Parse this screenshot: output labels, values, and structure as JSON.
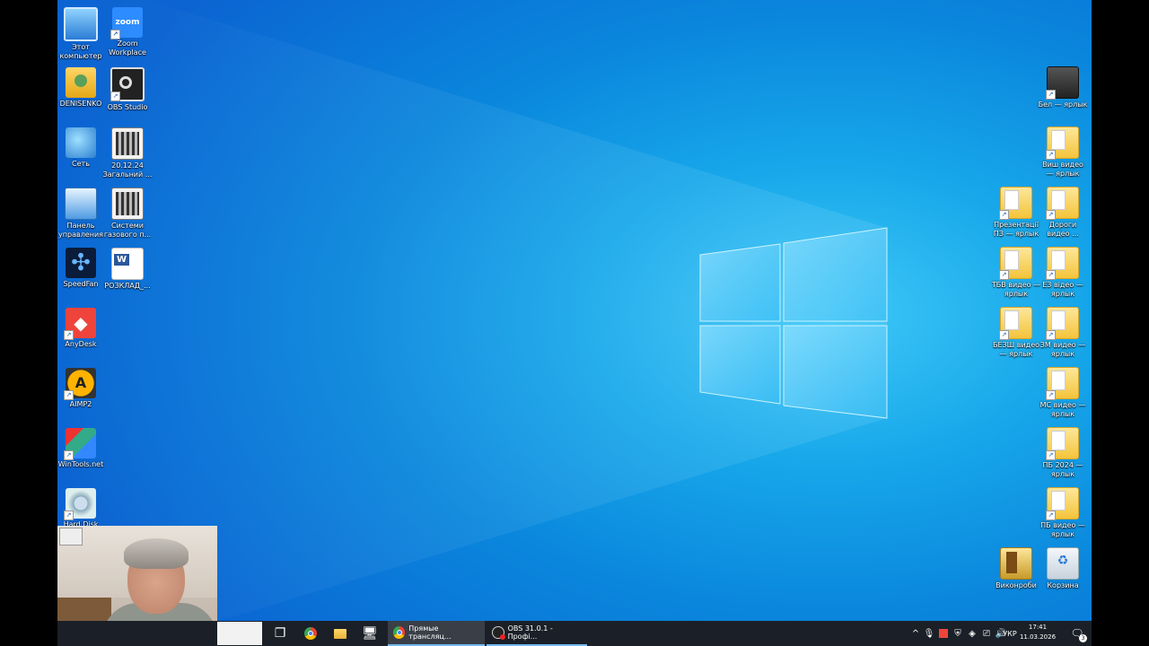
{
  "desktop": {
    "left_icons": [
      {
        "label": "Этот компьютер",
        "glyph": "computer-icon"
      },
      {
        "label": "Zoom Workplace",
        "glyph": "zoom-icon",
        "text": "zoom"
      },
      {
        "label": "DENISENKO",
        "glyph": "user-folder-icon"
      },
      {
        "label": "OBS Studio",
        "glyph": "obs-icon"
      },
      {
        "label": "Сеть",
        "glyph": "network-icon"
      },
      {
        "label": "20.12.24 Загальний ...",
        "glyph": "video-file-icon"
      },
      {
        "label": "Панель управления",
        "glyph": "control-panel-icon"
      },
      {
        "label": "Системи газового п...",
        "glyph": "video-file-icon"
      },
      {
        "label": "SpeedFan",
        "glyph": "fan-icon"
      },
      {
        "label": "РОЗКЛАД_...",
        "glyph": "word-document-icon"
      },
      {
        "label": "AnyDesk",
        "glyph": "anydesk-icon"
      },
      {
        "label": "AIMP2",
        "glyph": "aimp-icon"
      },
      {
        "label": "WinTools.net",
        "glyph": "wintools-icon"
      },
      {
        "label": "Hard Disk",
        "glyph": "hard-disk-icon"
      }
    ],
    "right_icons": [
      {
        "label": "Бел — ярлык",
        "glyph": "dark-folder-icon"
      },
      {
        "label": "Виш видео — ярлык",
        "glyph": "folder-shortcut-icon"
      },
      {
        "label": "Презентації ПЗ — ярлык",
        "glyph": "folder-shortcut-icon"
      },
      {
        "label": "Дороги видео ...",
        "glyph": "folder-shortcut-icon"
      },
      {
        "label": "ТБВ видео — ярлык",
        "glyph": "folder-shortcut-icon"
      },
      {
        "label": "ЕЗ відео — ярлык",
        "glyph": "folder-shortcut-icon"
      },
      {
        "label": "БЕЗШ видео — ярлык",
        "glyph": "folder-shortcut-icon"
      },
      {
        "label": "ЗМ видео — ярлык",
        "glyph": "folder-shortcut-icon"
      },
      {
        "label": "МС видео — ярлык",
        "glyph": "folder-shortcut-icon"
      },
      {
        "label": "ПБ 2024 — ярлык",
        "glyph": "folder-shortcut-icon"
      },
      {
        "label": "ПБ видео — ярлык",
        "glyph": "folder-shortcut-icon"
      },
      {
        "label": "Виконроби",
        "glyph": "door-folder-icon"
      },
      {
        "label": "Корзина",
        "glyph": "recycle-bin-icon"
      }
    ]
  },
  "taskbar": {
    "pinned": [
      "task-view-icon",
      "chrome-icon",
      "file-explorer-icon",
      "remote-desktop-icon"
    ],
    "apps": [
      {
        "label": "Прямые трансляц...",
        "glyph": "chrome-icon"
      },
      {
        "label": "OBS 31.0.1 - Профі...",
        "glyph": "obs-icon"
      }
    ],
    "tray": {
      "keyboard_layout": "УКР",
      "time": "17:41",
      "date": "11.03.2026",
      "notification_count": "3"
    }
  },
  "colors": {
    "desktop_blue": "#0b6fd6",
    "taskbar": "#1b2028",
    "accent": "#76b9ed"
  }
}
